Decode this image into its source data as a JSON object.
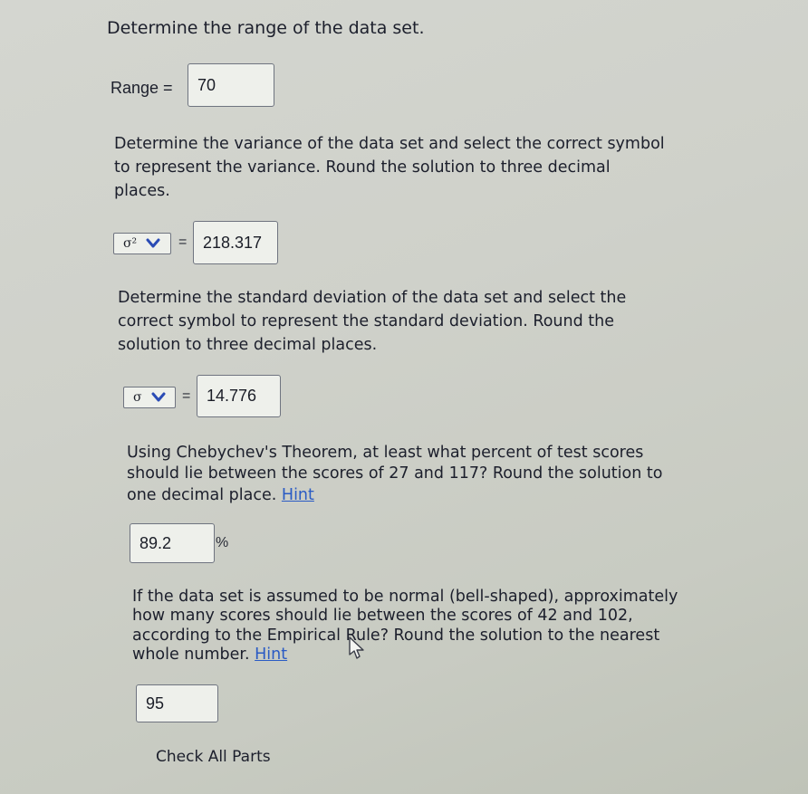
{
  "questions": {
    "range": {
      "title": "Determine the range of the data set.",
      "label": "Range =",
      "value": "70"
    },
    "variance": {
      "line1": "Determine the variance of the data set and select the correct symbol",
      "line2": "to represent the variance. Round the solution to three decimal",
      "line3": "places.",
      "symbol": "σ²",
      "equals": "=",
      "value": "218.317"
    },
    "std_dev": {
      "line1": "Determine the standard deviation of the data set and select the",
      "line2": "correct symbol to represent the standard deviation. Round the",
      "line3": "solution to three decimal places.",
      "symbol": "σ",
      "equals": "=",
      "value": "14.776"
    },
    "chebyshev": {
      "line1": "Using Chebychev's Theorem, at least what percent of test scores",
      "line2": "should lie between the scores of 27 and 117? Round the solution to",
      "line3": "one decimal place.",
      "hint": "Hint",
      "value": "89.2",
      "unit": "%"
    },
    "empirical": {
      "line1": "If the data set is assumed to be normal (bell-shaped), approximately",
      "line2": "how many scores should lie between the scores of 42 and 102,",
      "line3": "according to the Empirical Rule? Round the solution to the nearest",
      "line4": "whole number.",
      "hint": "Hint",
      "value": "95"
    }
  },
  "actions": {
    "check_all": "Check All Parts"
  },
  "icons": {
    "dropdown": "chevron-down-icon",
    "cursor": "mouse-pointer-icon"
  }
}
